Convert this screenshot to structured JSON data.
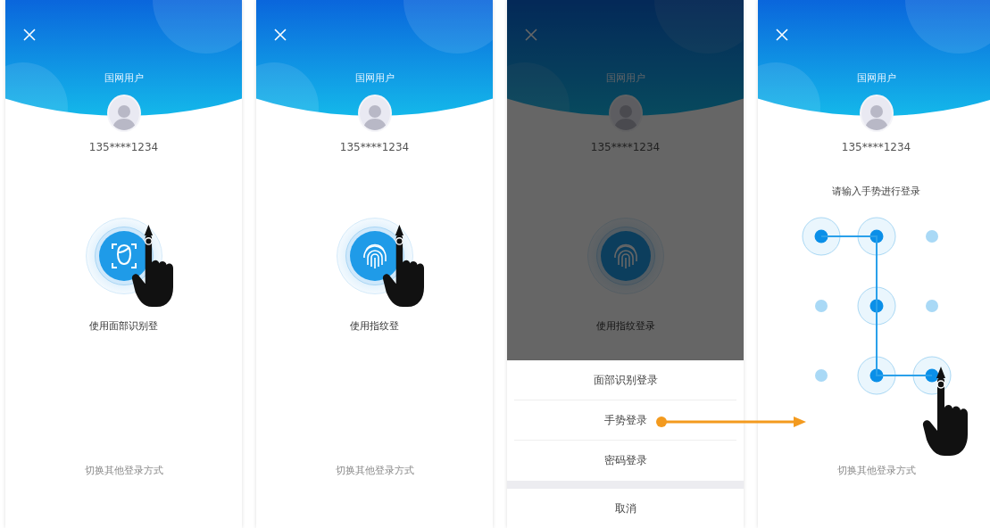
{
  "screens": [
    {
      "kind": "biometric",
      "scanner": {
        "kind": "face"
      },
      "dimmed": false,
      "touch": true,
      "user_label": "国网用户",
      "phone": "135****1234",
      "action_label": "使用面部识别登",
      "switch_link": "切换其他登录方式"
    },
    {
      "kind": "biometric",
      "scanner": {
        "kind": "fingerprint"
      },
      "dimmed": false,
      "touch": true,
      "user_label": "国网用户",
      "phone": "135****1234",
      "action_label": "使用指纹登",
      "switch_link": "切换其他登录方式"
    },
    {
      "kind": "biometric",
      "scanner": {
        "kind": "fingerprint"
      },
      "dimmed": true,
      "touch": false,
      "user_label": "国网用户",
      "phone": "135****1234",
      "action_label": "使用指纹登录",
      "sheet": {
        "options": [
          {
            "label": "面部识别登录",
            "selected": false
          },
          {
            "label": "手势登录",
            "selected": true
          },
          {
            "label": "密码登录",
            "selected": false
          }
        ],
        "cancel": "取消"
      }
    },
    {
      "kind": "gesture",
      "dimmed": false,
      "touch": true,
      "user_label": "国网用户",
      "phone": "135****1234",
      "prompt": "请输入手势进行登录",
      "dots": [
        {
          "selected": true
        },
        {
          "selected": true
        },
        {
          "selected": false
        },
        {
          "selected": false
        },
        {
          "selected": true
        },
        {
          "selected": false
        },
        {
          "selected": false
        },
        {
          "selected": true
        },
        {
          "selected": true
        }
      ],
      "switch_link": "切换其他登录方式"
    }
  ]
}
